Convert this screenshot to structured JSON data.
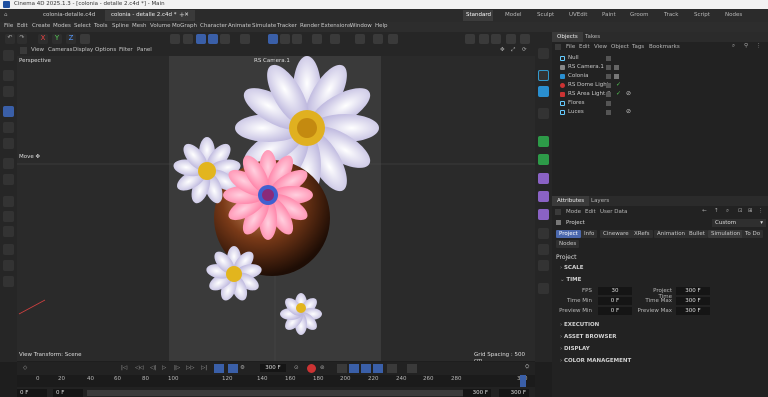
{
  "window": {
    "title": "Cinema 4D 2025.1.3 - [colonia - detalle 2.c4d *] - Main"
  },
  "doc_tabs": [
    "colonia-detalle.c4d",
    "colonia - detalle 2.c4d *"
  ],
  "layouts": [
    "Standard",
    "Model",
    "Sculpt",
    "UVEdit",
    "Paint",
    "Groom",
    "Track",
    "Script",
    "Nodes"
  ],
  "menu": [
    "File",
    "Edit",
    "Create",
    "Modes",
    "Select",
    "Tools",
    "Spline",
    "Mesh",
    "Volume",
    "MoGraph",
    "Character",
    "Animate",
    "Simulate",
    "Tracker",
    "Render",
    "Extensions",
    "Window",
    "Help"
  ],
  "viewport": {
    "menu": [
      "View",
      "Cameras",
      "Display",
      "Options",
      "Filter",
      "Panel"
    ],
    "label": "Perspective",
    "camera": "RS Camera.1",
    "hud": "Move ✥",
    "view_transform": "View Transform: Scene",
    "grid": "Grid Spacing : 500 cm"
  },
  "objects_panel": {
    "tabs": [
      "Objects",
      "Takes"
    ],
    "menu": [
      "File",
      "Edit",
      "View",
      "Object",
      "Tags",
      "Bookmarks"
    ],
    "items": [
      "Null",
      "RS Camera.1",
      "Colonia",
      "RS Dome Light",
      "RS Area Light.2",
      "Flores",
      "Luces"
    ]
  },
  "attributes": {
    "tabs": [
      "Attributes",
      "Layers"
    ],
    "menu": [
      "Mode",
      "Edit",
      "User Data"
    ],
    "mode": "Project",
    "dropdown": "Custom",
    "chips": [
      "Project",
      "Info",
      "Cineware",
      "XRefs",
      "Animation",
      "Bullet",
      "Simulation",
      "To Do",
      "Nodes"
    ],
    "heading": "Project",
    "sections": [
      "SCALE",
      "TIME",
      "EXECUTION",
      "ASSET BROWSER",
      "DISPLAY",
      "COLOR MANAGEMENT"
    ],
    "fields": [
      {
        "label": "FPS",
        "value": "30",
        "label2": "Project Time",
        "value2": "300 F"
      },
      {
        "label": "Time Min",
        "value": "0 F",
        "label2": "Time Max",
        "value2": "300 F"
      },
      {
        "label": "Preview Min",
        "value": "0 F",
        "label2": "Preview Max",
        "value2": "300 F"
      }
    ]
  },
  "timeline": {
    "current": "300 F",
    "ticks": [
      "0",
      "20",
      "40",
      "60",
      "80",
      "100",
      "120",
      "140",
      "160",
      "180",
      "200",
      "220",
      "240",
      "260",
      "280",
      "300"
    ],
    "start": "0 F",
    "end_a": "0 F",
    "end_b": "300 F",
    "end_c": "300 F"
  }
}
